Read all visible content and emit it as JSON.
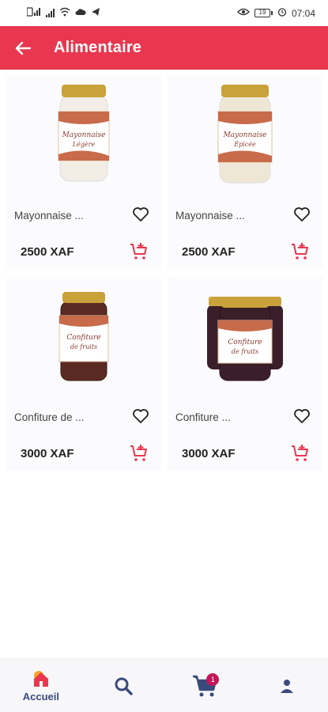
{
  "status_bar": {
    "time": "07:04",
    "battery": "19",
    "left_icons": [
      "sim-icon",
      "signal-icon",
      "wifi-icon",
      "cloud-icon",
      "telegram-icon"
    ],
    "right_icons": [
      "eye-icon",
      "battery-icon",
      "alarm-icon"
    ]
  },
  "app_bar": {
    "title": "Alimentaire",
    "back_icon": "arrow-left-icon"
  },
  "products": [
    {
      "name": "Mayonnaise ...",
      "price": "2500 XAF",
      "jar_label": "Mayonnaise",
      "jar_sub": "Légère",
      "fill": "#f2eee5",
      "lid": "#c9a23a",
      "label": "#ffffff"
    },
    {
      "name": "Mayonnaise ...",
      "price": "2500 XAF",
      "jar_label": "Mayonnaise",
      "jar_sub": "Épicée",
      "fill": "#efe7d6",
      "lid": "#c9a23a",
      "label": "#ffffff"
    },
    {
      "name": "Confiture de ...",
      "price": "3000 XAF",
      "jar_label": "Confiture",
      "jar_sub": "de fruits",
      "fill": "#5b2a22",
      "lid": "#c9a23a",
      "label": "#ffffff"
    },
    {
      "name": "Confiture ...",
      "price": "3000 XAF",
      "jar_label": "Confiture",
      "jar_sub": "de fruits",
      "fill": "#3a1f2a",
      "lid": "#c9a23a",
      "label": "#ffffff"
    }
  ],
  "bottom_nav": {
    "home_label": "Accueil",
    "cart_badge": "1"
  },
  "colors": {
    "primary": "#e8374f",
    "nav": "#3a4a7c",
    "home_active": "#e8374f"
  }
}
